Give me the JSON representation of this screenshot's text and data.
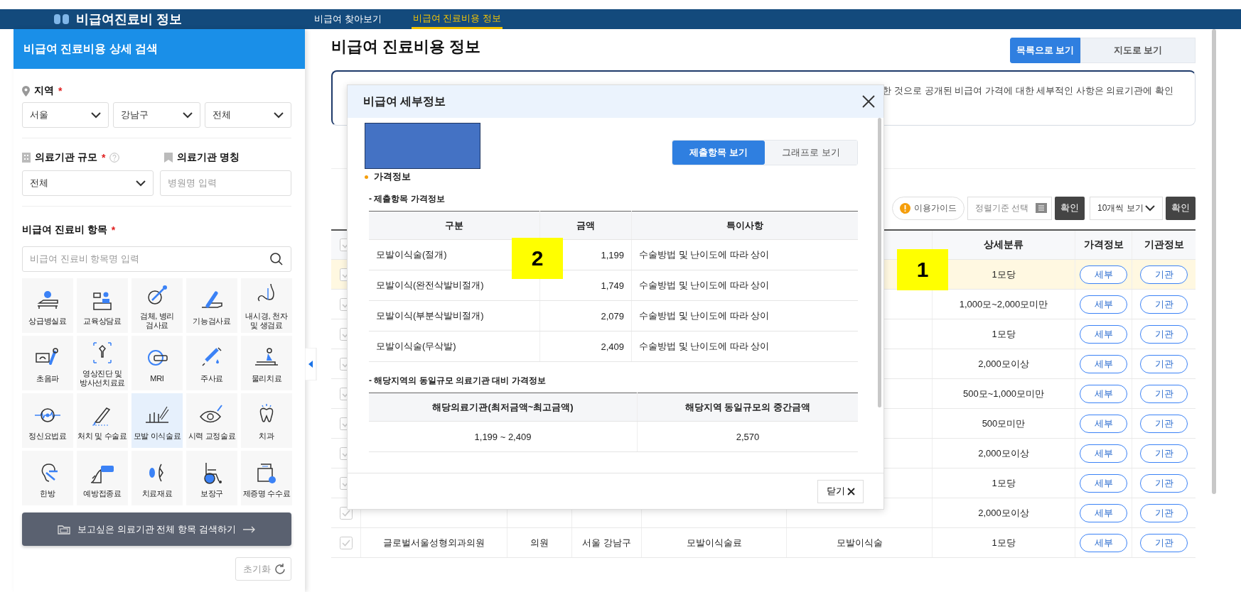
{
  "header": {
    "logo": "비급여진료비 정보",
    "nav": [
      {
        "label": "비급여 찾아보기",
        "selected": false
      },
      {
        "label": "비급여 진료비용 정보",
        "selected": true
      }
    ]
  },
  "sidebar": {
    "title": "비급여 진료비용 상세 검색",
    "region": {
      "label": "지역",
      "mark": "*",
      "selects": [
        "서울",
        "강남구",
        "전체"
      ]
    },
    "size": {
      "label": "의료기관 규모",
      "mark": "*",
      "select": "전체"
    },
    "name": {
      "label": "의료기관 명칭",
      "placeholder": "병원명 입력"
    },
    "items": {
      "label": "비급여 진료비 항목",
      "mark": "*",
      "placeholder": "비급여 진료비 항목명 입력",
      "tiles": [
        {
          "label": "상급병실료",
          "selected": false
        },
        {
          "label": "교육상담료",
          "selected": false
        },
        {
          "label": "검체, 병리 검사료",
          "selected": false
        },
        {
          "label": "기능검사료",
          "selected": false
        },
        {
          "label": "내시경, 천자 및 생검료",
          "selected": false
        },
        {
          "label": "초음파",
          "selected": false
        },
        {
          "label": "영상진단 및 방사선치료료",
          "selected": false
        },
        {
          "label": "MRI",
          "selected": false
        },
        {
          "label": "주사료",
          "selected": false
        },
        {
          "label": "물리치료",
          "selected": false
        },
        {
          "label": "정신요법료",
          "selected": false
        },
        {
          "label": "처치 및 수술료",
          "selected": false
        },
        {
          "label": "모발 이식술료",
          "selected": true
        },
        {
          "label": "시력 교정술료",
          "selected": false
        },
        {
          "label": "치과",
          "selected": false
        },
        {
          "label": "한방",
          "selected": false
        },
        {
          "label": "예방접종료",
          "selected": false
        },
        {
          "label": "치료재료",
          "selected": false
        },
        {
          "label": "보장구",
          "selected": false
        },
        {
          "label": "제증명 수수료",
          "selected": false
        }
      ]
    },
    "search_all_button": "보고싶은 의료기관 전체 항목 검색하기",
    "reset_button": "초기화"
  },
  "main": {
    "title": "비급여 진료비용 정보",
    "view_tabs": [
      {
        "label": "목록으로 보기",
        "selected": true
      },
      {
        "label": "지도로 보기",
        "selected": false
      }
    ],
    "notice": "한 것으로 공개된 비급여 가격에 대한 세부적인 사항은 의료기관에 확인",
    "toolbar": {
      "guide": "이용가이드",
      "sort_placeholder": "정렬기준 선택",
      "confirm": "확인",
      "page_size": "10개씩 보기",
      "confirm_2": "확인"
    },
    "table": {
      "select_all": {
        "checked": false
      },
      "columns": [
        "상세분류",
        "가격정보",
        "기관정보"
      ],
      "rows": [
        {
          "checked": false,
          "selected": true,
          "detail": "1모당",
          "price_button": "세부",
          "org_button": "기관"
        },
        {
          "checked": false,
          "selected": false,
          "detail": "1,000모~2,000모미만",
          "price_button": "세부",
          "org_button": "기관"
        },
        {
          "checked": false,
          "selected": false,
          "detail": "1모당",
          "price_button": "세부",
          "org_button": "기관"
        },
        {
          "checked": false,
          "selected": false,
          "detail": "2,000모이상",
          "price_button": "세부",
          "org_button": "기관"
        },
        {
          "checked": false,
          "selected": false,
          "detail": "500모~1,000모미만",
          "price_button": "세부",
          "org_button": "기관"
        },
        {
          "checked": false,
          "selected": false,
          "detail": "500모미만",
          "price_button": "세부",
          "org_button": "기관"
        },
        {
          "checked": false,
          "selected": false,
          "detail": "2,000모이상",
          "price_button": "세부",
          "org_button": "기관"
        },
        {
          "checked": false,
          "selected": false,
          "detail": "1모당",
          "price_button": "세부",
          "org_button": "기관"
        },
        {
          "checked": false,
          "selected": false,
          "detail": "2,000모이상",
          "price_button": "세부",
          "org_button": "기관"
        },
        {
          "checked": false,
          "selected": false,
          "name": "글로벌서울성형외과의원",
          "type": "의원",
          "region": "서울 강남구",
          "item": "모발이식술료",
          "subitem": "모발이식술",
          "detail": "1모당",
          "price_button": "세부",
          "org_button": "기관"
        }
      ]
    }
  },
  "modal": {
    "title": "비급여 세부정보",
    "tabs": [
      {
        "label": "제출항목 보기",
        "selected": true
      },
      {
        "label": "그래프로 보기",
        "selected": false
      }
    ],
    "section": "가격정보",
    "price_table": {
      "caption": "- 제출항목 가격정보",
      "columns": [
        "구분",
        "금액",
        "특이사항"
      ],
      "rows": [
        [
          "모발이식술(절개)",
          "1,199",
          "수술방법 및 난이도에 따라 상이"
        ],
        [
          "모발이식(완전삭발비절개)",
          "1,749",
          "수술방법 및 난이도에 따라 상이"
        ],
        [
          "모발이식(부분삭발비절개)",
          "2,079",
          "수술방법 및 난이도에 따라 상이"
        ],
        [
          "모발이식술(무삭발)",
          "2,409",
          "수술방법 및 난이도에 따라 상이"
        ]
      ]
    },
    "compare_table": {
      "caption": "- 해당지역의 동일규모 의료기관 대비 가격정보",
      "columns": [
        "해당의료기관(최저금액~최고금액)",
        "해당지역 동일규모의 중간금액"
      ],
      "rows": [
        [
          "1,199 ~ 2,409",
          "2,570"
        ]
      ]
    },
    "close_button": "닫기"
  },
  "annotations": [
    {
      "label": "1"
    },
    {
      "label": "2"
    }
  ]
}
